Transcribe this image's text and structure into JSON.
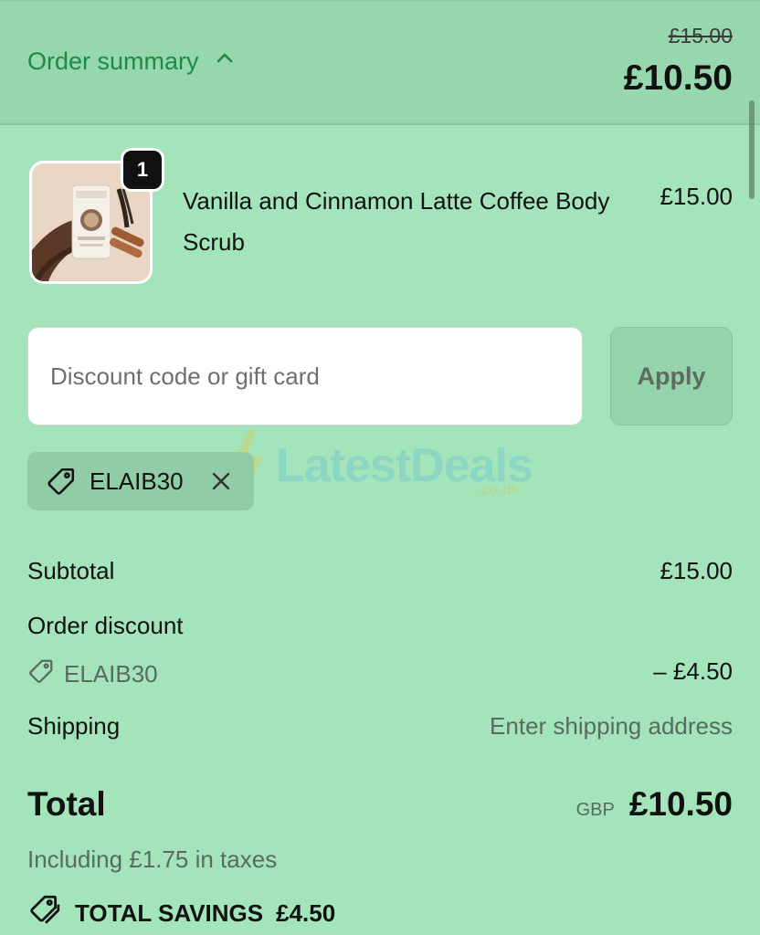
{
  "header": {
    "summary_label": "Order summary",
    "compare_price": "£15.00",
    "total": "£10.50"
  },
  "product": {
    "quantity": "1",
    "name": "Vanilla and Cinnamon Latte Coffee Body Scrub",
    "price": "£15.00"
  },
  "discount": {
    "placeholder": "Discount code or gift card",
    "apply_label": "Apply",
    "applied_code": "ELAIB30"
  },
  "watermark": {
    "text": "LatestDeals",
    "sub": ".co.uk"
  },
  "summary": {
    "subtotal_label": "Subtotal",
    "subtotal_value": "£15.00",
    "order_discount_label": "Order discount",
    "discount_code": "ELAIB30",
    "discount_value": "– £4.50",
    "shipping_label": "Shipping",
    "shipping_value": "Enter shipping address",
    "total_label": "Total",
    "currency": "GBP",
    "total_value": "£10.50",
    "taxes_note": "Including £1.75 in taxes",
    "savings_label": "TOTAL SAVINGS",
    "savings_value": "£4.50"
  },
  "colors": {
    "background": "#a3e4bb",
    "header": "#97d7ae",
    "accent_link": "#1d8a4a"
  },
  "icons": {
    "toggle": "chevron-up-icon",
    "tag": "tag-icon",
    "remove": "close-icon",
    "savings": "double-tag-icon"
  }
}
